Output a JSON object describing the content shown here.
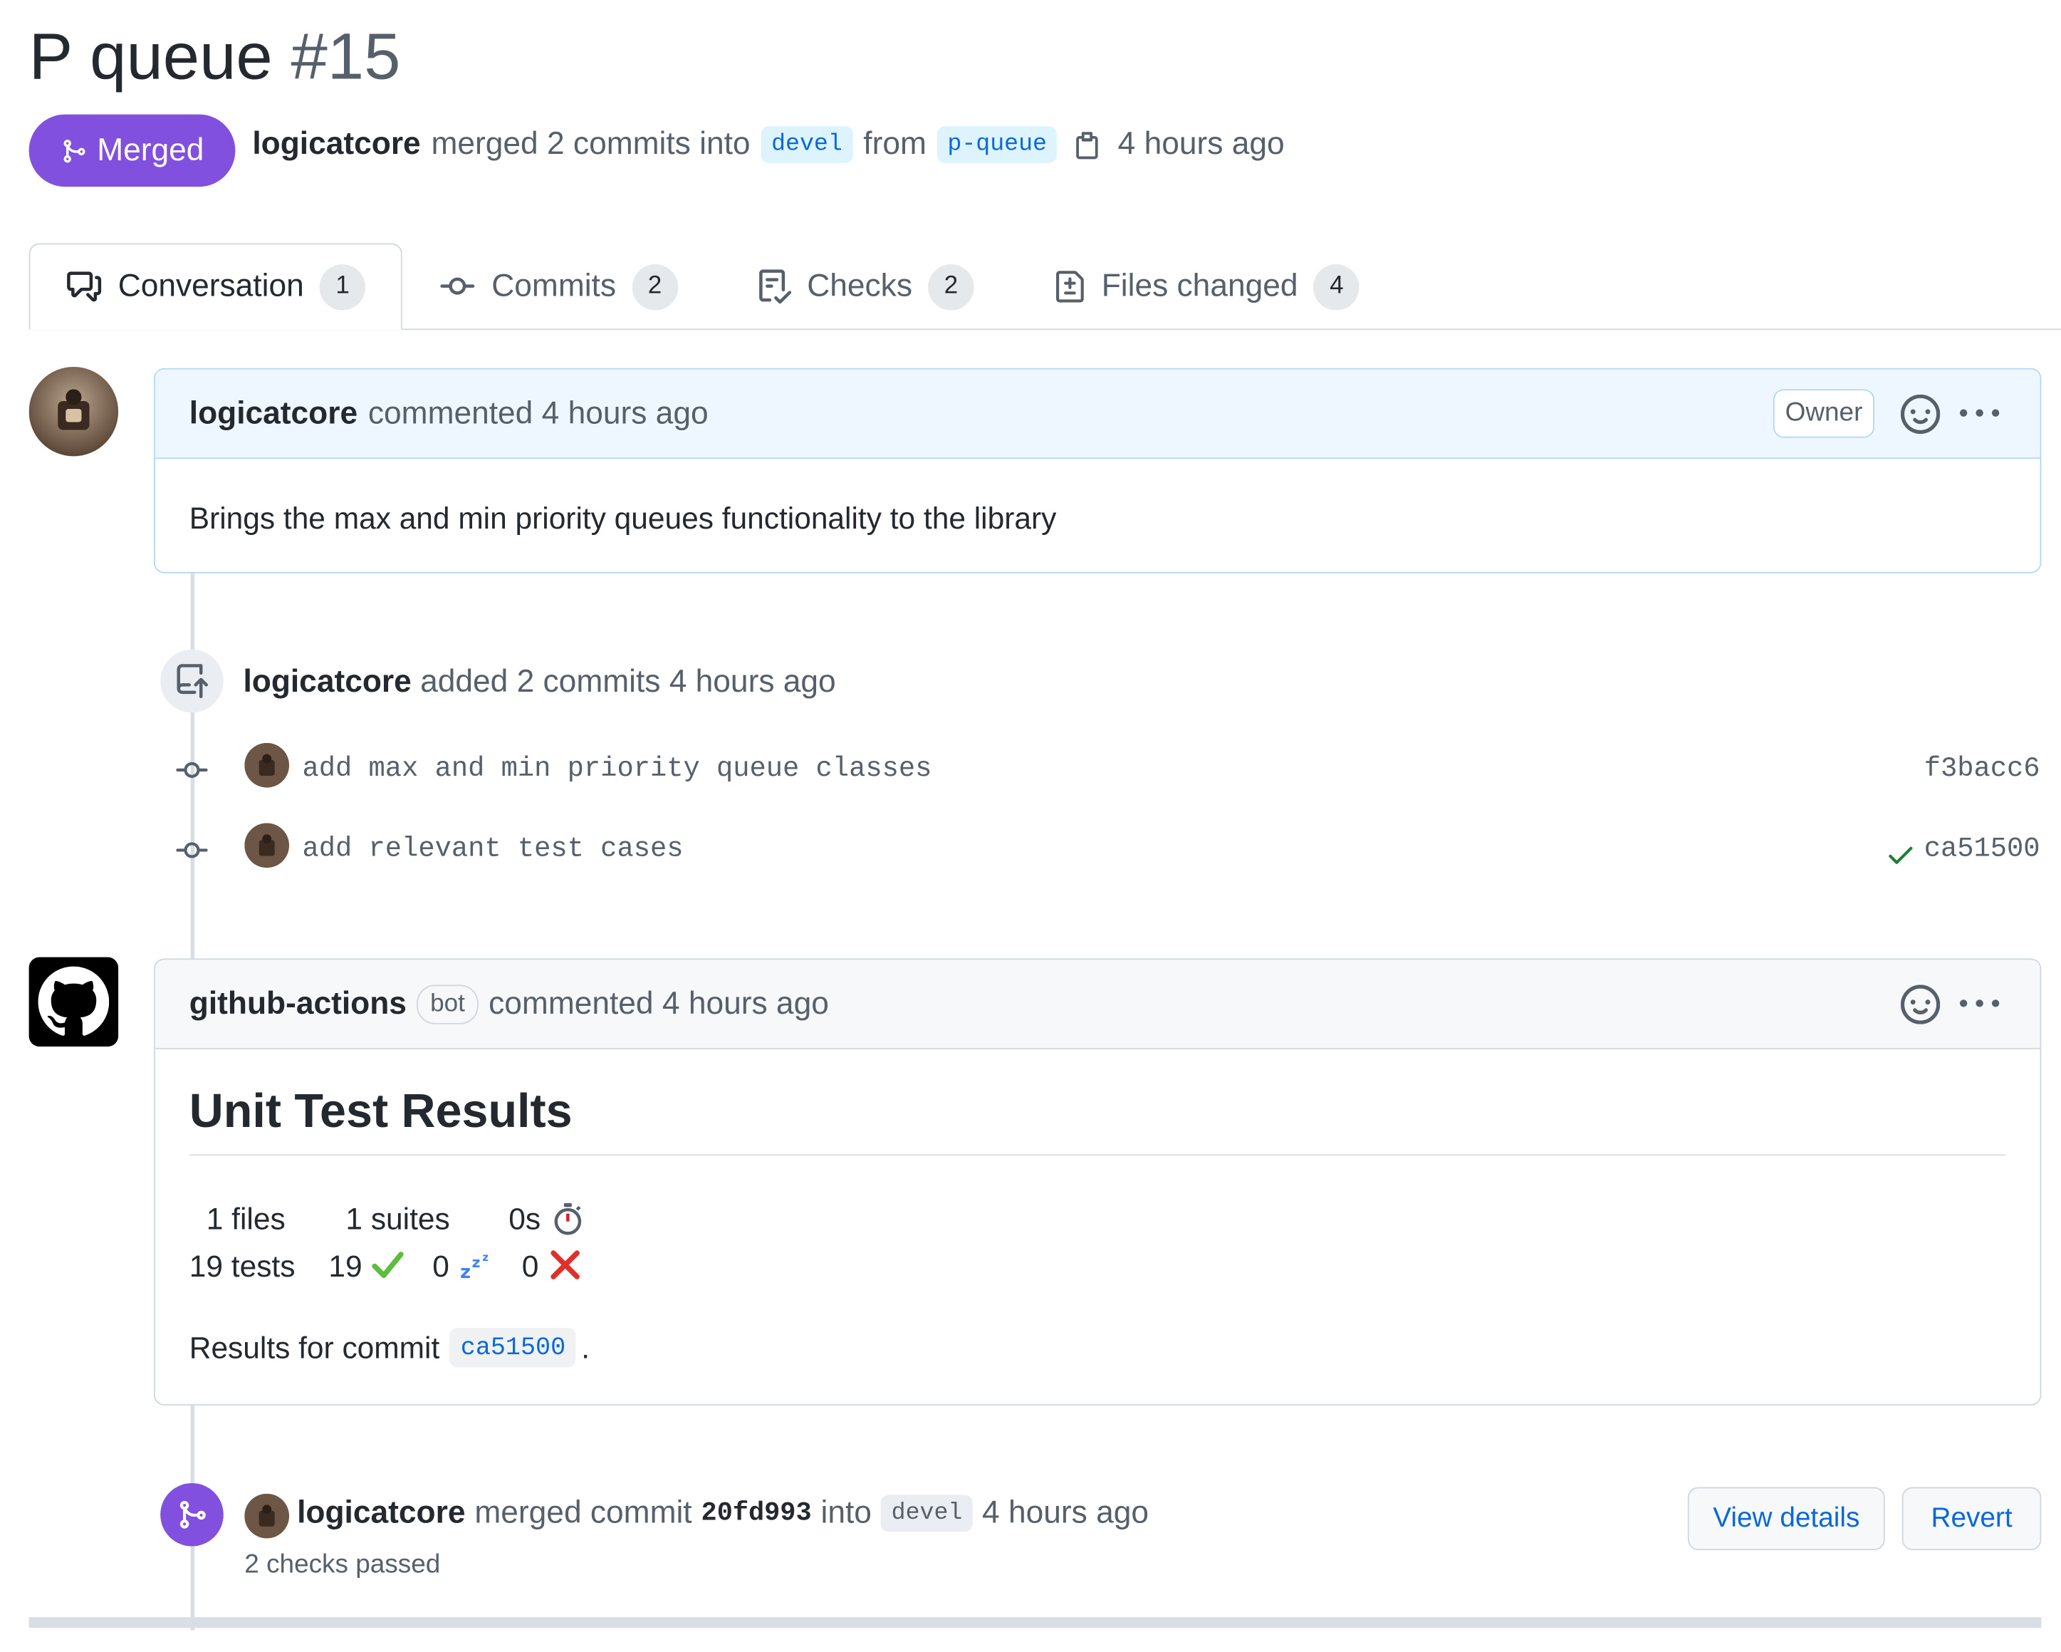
{
  "pr": {
    "title": "P queue",
    "number": "#15",
    "status": "Merged",
    "author": "logicatcore",
    "merged_text": "merged 2 commits into",
    "base_branch": "devel",
    "from_text": "from",
    "head_branch": "p-queue",
    "time": "4 hours ago"
  },
  "tabs": [
    {
      "label": "Conversation",
      "count": "1",
      "icon": "comment-discussion-icon"
    },
    {
      "label": "Commits",
      "count": "2",
      "icon": "git-commit-icon"
    },
    {
      "label": "Checks",
      "count": "2",
      "icon": "checklist-icon"
    },
    {
      "label": "Files changed",
      "count": "4",
      "icon": "file-diff-icon"
    }
  ],
  "comment1": {
    "author": "logicatcore",
    "action": "commented 4 hours ago",
    "badge": "Owner",
    "body": "Brings the max and min priority queues functionality to the library"
  },
  "commits_event": {
    "author": "logicatcore",
    "action": "added 2 commits 4 hours ago",
    "commits": [
      {
        "message": "add max and min priority queue classes",
        "sha": "f3bacc6",
        "checked": false
      },
      {
        "message": "add relevant test cases",
        "sha": "ca51500",
        "checked": true
      }
    ]
  },
  "comment2": {
    "author": "github-actions",
    "bot_label": "bot",
    "action": "commented 4 hours ago",
    "heading": "Unit Test Results",
    "stats_row1": {
      "files": "1 files",
      "suites": "1 suites",
      "time": "0s"
    },
    "stats_row2": {
      "tests": "19 tests",
      "passed": "19",
      "skipped": "0",
      "failed": "0"
    },
    "results_prefix": "Results for commit",
    "results_sha": "ca51500",
    "results_suffix": "."
  },
  "merge_event": {
    "author": "logicatcore",
    "text1": "merged commit",
    "sha": "20fd993",
    "text2": "into",
    "branch": "devel",
    "time": "4 hours ago",
    "checks": "2 checks passed",
    "view_details": "View details",
    "revert": "Revert"
  },
  "colors": {
    "merged_purple": "#8250df",
    "link_blue": "#0969da",
    "success_green": "#1a7f37",
    "fail_red": "#cf222e"
  }
}
